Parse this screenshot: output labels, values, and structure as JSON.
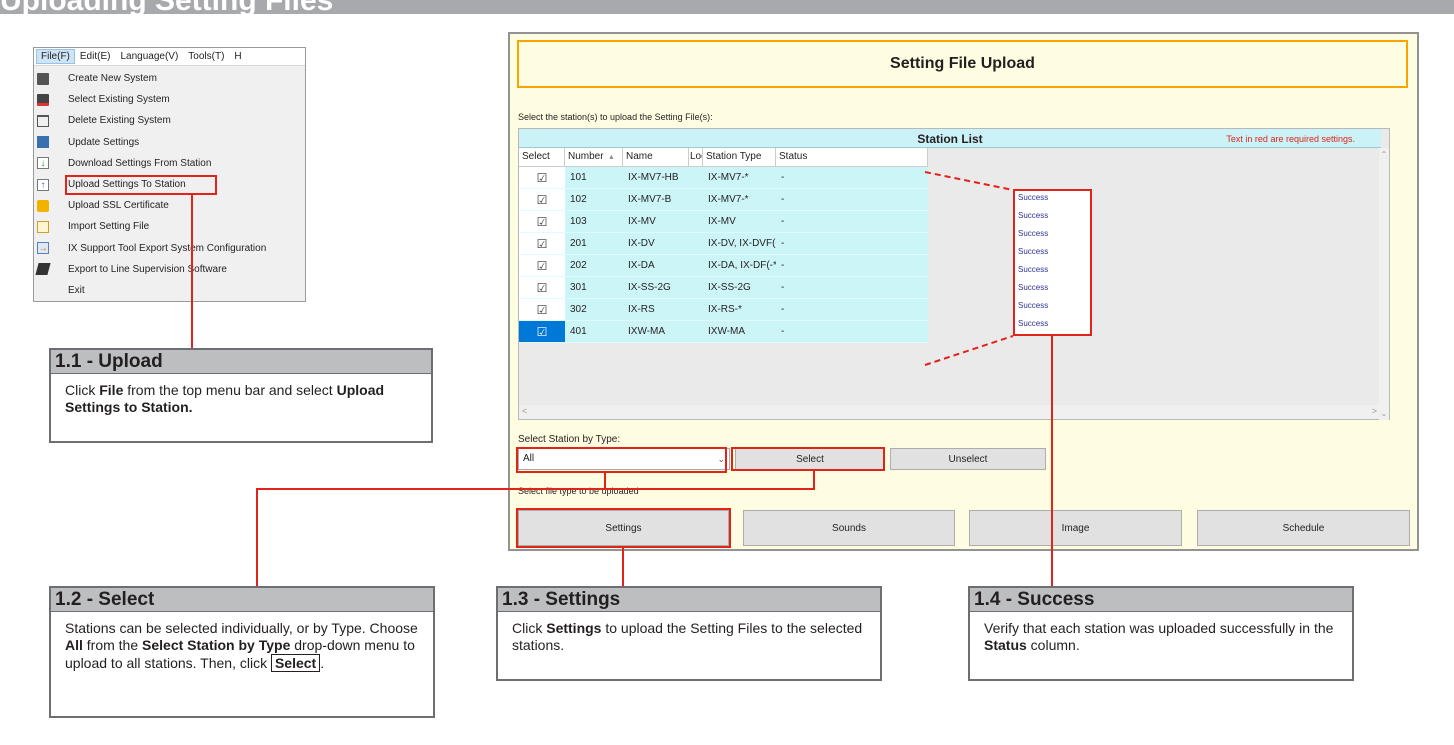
{
  "banner": {
    "title": "Uploading Setting Files"
  },
  "file_menu": {
    "menubar": [
      {
        "label": "File(F)"
      },
      {
        "label": "Edit(E)"
      },
      {
        "label": "Language(V)"
      },
      {
        "label": "Tools(T)"
      },
      {
        "label": "H"
      }
    ],
    "items": [
      {
        "label": "Create New System",
        "icon": "create-system-icon"
      },
      {
        "label": "Select Existing System",
        "icon": "select-system-icon"
      },
      {
        "label": "Delete Existing System",
        "icon": "delete-system-icon"
      },
      {
        "label": "Update Settings",
        "icon": "save-icon"
      },
      {
        "label": "Download Settings From Station",
        "icon": "download-icon"
      },
      {
        "label": "Upload Settings To Station",
        "icon": "upload-icon"
      },
      {
        "label": "Upload SSL Certificate",
        "icon": "lock-icon"
      },
      {
        "label": "Import Setting File",
        "icon": "import-icon"
      },
      {
        "label": "IX Support Tool Export System Configuration",
        "icon": "export-icon"
      },
      {
        "label": "Export to Line Supervision Software",
        "icon": "line-supervision-icon"
      },
      {
        "label": "Exit",
        "icon": ""
      }
    ]
  },
  "window": {
    "title": "Setting File Upload",
    "prompt": "Select the station(s) to upload the Setting File(s):",
    "list_title": "Station List",
    "required_note": "Text in red are required settings.",
    "columns": [
      "Select",
      "Number",
      "Name",
      "Loc",
      "Station Type",
      "Status"
    ],
    "sort_indicator": "▴",
    "rows": [
      {
        "checked": "☑",
        "number": "101",
        "name": "IX-MV7-HB",
        "loc": "",
        "type": "IX-MV7-*",
        "status": "-"
      },
      {
        "checked": "☑",
        "number": "102",
        "name": "IX-MV7-B",
        "loc": "",
        "type": "IX-MV7-*",
        "status": "-"
      },
      {
        "checked": "☑",
        "number": "103",
        "name": "IX-MV",
        "loc": "",
        "type": "IX-MV",
        "status": "-"
      },
      {
        "checked": "☑",
        "number": "201",
        "name": "IX-DV",
        "loc": "",
        "type": "IX-DV, IX-DVF(-",
        "status": "-"
      },
      {
        "checked": "☑",
        "number": "202",
        "name": "IX-DA",
        "loc": "",
        "type": "IX-DA, IX-DF(-*)",
        "status": "-"
      },
      {
        "checked": "☑",
        "number": "301",
        "name": "IX-SS-2G",
        "loc": "",
        "type": "IX-SS-2G",
        "status": "-"
      },
      {
        "checked": "☑",
        "number": "302",
        "name": "IX-RS",
        "loc": "",
        "type": "IX-RS-*",
        "status": "-"
      },
      {
        "checked": "☑",
        "number": "401",
        "name": "IXW-MA",
        "loc": "",
        "type": "IXW-MA",
        "status": "-"
      }
    ],
    "select_by_type_label": "Select Station by Type:",
    "type_value": "All",
    "select_button": "Select",
    "unselect_button": "Unselect",
    "file_type_label": "Select file type to be uploaded",
    "file_buttons": [
      "Settings",
      "Sounds",
      "Image",
      "Schedule"
    ],
    "success_statuses": [
      "Success",
      "Success",
      "Success",
      "Success",
      "Success",
      "Success",
      "Success",
      "Success"
    ]
  },
  "callouts": {
    "c1": {
      "title": "1.1 - Upload"
    },
    "c2": {
      "title": "1.2 - Select"
    },
    "c3": {
      "title": "1.3 - Settings"
    },
    "c4": {
      "title": "1.4 - Success"
    }
  },
  "colors": {
    "highlight_red": "#e2231a",
    "title_border": "#f7a600",
    "list_cyan": "#ccf5f8",
    "success_blue": "#2e3192",
    "callout_header": "#bcbec0"
  }
}
